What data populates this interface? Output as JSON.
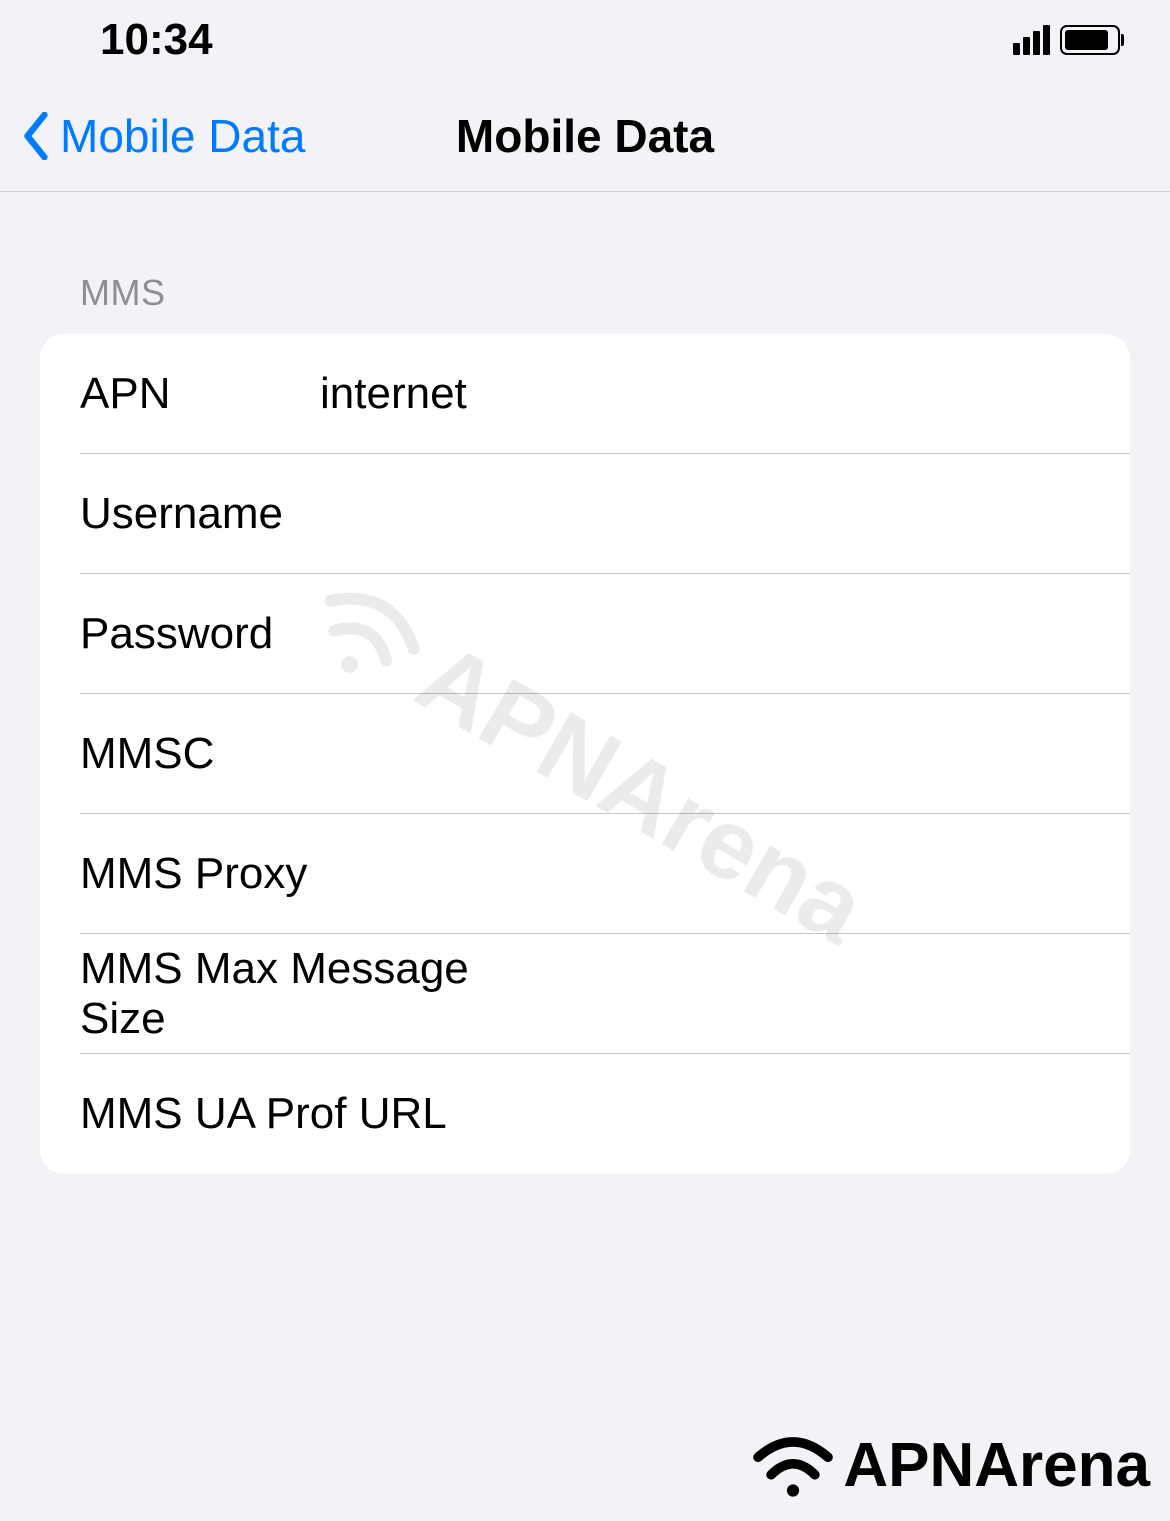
{
  "statusBar": {
    "time": "10:34"
  },
  "navBar": {
    "backLabel": "Mobile Data",
    "title": "Mobile Data"
  },
  "section": {
    "header": "MMS",
    "rows": [
      {
        "label": "APN",
        "value": "internet"
      },
      {
        "label": "Username",
        "value": ""
      },
      {
        "label": "Password",
        "value": ""
      },
      {
        "label": "MMSC",
        "value": ""
      },
      {
        "label": "MMS Proxy",
        "value": ""
      },
      {
        "label": "MMS Max Message Size",
        "value": ""
      },
      {
        "label": "MMS UA Prof URL",
        "value": ""
      }
    ]
  },
  "watermark": {
    "text": "APNArena"
  },
  "brand": {
    "text": "APNArena"
  }
}
